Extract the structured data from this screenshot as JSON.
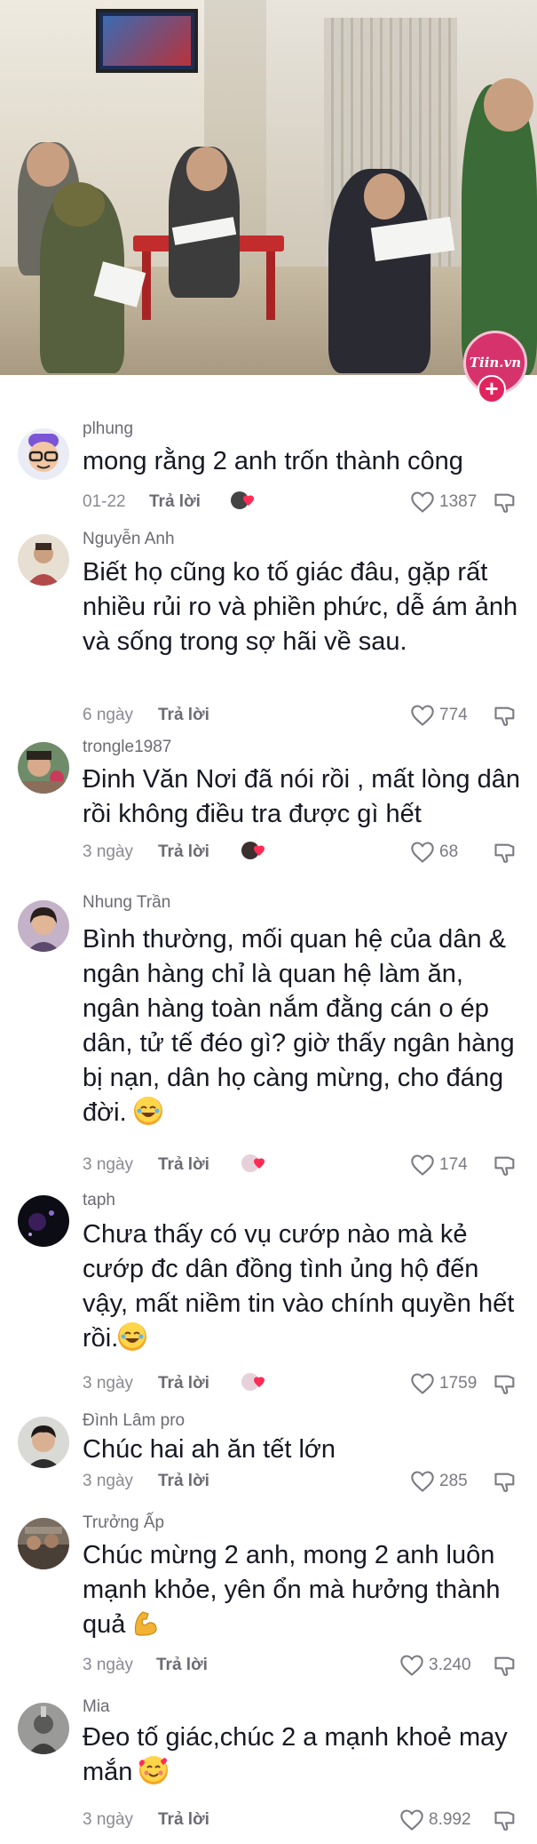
{
  "header": {
    "logo_text": "Tiin.vn",
    "plus_label": "+"
  },
  "colors": {
    "text": "#161823",
    "meta": "#8a8a92",
    "band": "#c2185b"
  },
  "comments": [
    {
      "username": "plhung",
      "text": "mong rằng 2 anh trốn thành công",
      "date": "01-22",
      "reply_label": "Trả lời",
      "likes": "1387",
      "creator_liked": true,
      "avatar": "memoji-avatar",
      "emoji": ""
    },
    {
      "username": "Nguyễn Anh",
      "text": "Biết họ cũng ko tố giác đâu, gặp rất nhiều rủi ro và phiền phức, dễ ám ảnh và sống trong sợ hãi về sau.",
      "date": "6 ngày",
      "reply_label": "Trả lời",
      "likes": "774",
      "creator_liked": false,
      "avatar": "portrait-avatar",
      "emoji": ""
    },
    {
      "username": "trongle1987",
      "text": "Đinh Văn Nơi đã nói rồi , mất lòng dân rồi không điều tra được gì hết",
      "date": "3 ngày",
      "reply_label": "Trả lời",
      "likes": "68",
      "creator_liked": true,
      "avatar": "selfie-avatar",
      "emoji": ""
    },
    {
      "username": "Nhung Trần",
      "text": "Bình thường, mối quan hệ của dân & ngân hàng chỉ là quan hệ làm ăn, ngân hàng toàn nắm đằng cán o ép dân, tử tế đéo gì? giờ thấy ngân hàng bị nạn, dân họ càng mừng, cho đáng đời.",
      "date": "3 ngày",
      "reply_label": "Trả lời",
      "likes": "174",
      "creator_liked": true,
      "avatar": "woman-avatar",
      "emoji": "laughing-emoji"
    },
    {
      "username": "taph",
      "text": "Chưa thấy có vụ cướp nào mà kẻ cướp đc dân đồng tình ủng hộ đến vậy, mất niềm tin vào chính quyền hết rồi.",
      "date": "3 ngày",
      "reply_label": "Trả lời",
      "likes": "1759",
      "creator_liked": true,
      "avatar": "dark-avatar",
      "emoji": "laughing-emoji"
    },
    {
      "username": "Đình Lâm pro",
      "text": "Chúc hai ah ăn tết lớn",
      "date": "3 ngày",
      "reply_label": "Trả lời",
      "likes": "285",
      "creator_liked": false,
      "avatar": "man-avatar",
      "emoji": ""
    },
    {
      "username": "Trưởng Ấp",
      "text": "Chúc mừng 2 anh, mong 2 anh luôn mạnh khỏe, yên ổn mà hưởng thành quả",
      "date": "3 ngày",
      "reply_label": "Trả lời",
      "likes": "3.240",
      "creator_liked": false,
      "avatar": "group-avatar",
      "emoji": "flexed-biceps-emoji"
    },
    {
      "username": "Mia",
      "text": "Đeo tố giác,chúc 2 a mạnh khoẻ may mắn",
      "date": "3 ngày",
      "reply_label": "Trả lời",
      "likes": "8.992",
      "creator_liked": false,
      "avatar": "gray-avatar",
      "emoji": "smiling-hearts-emoji"
    }
  ]
}
